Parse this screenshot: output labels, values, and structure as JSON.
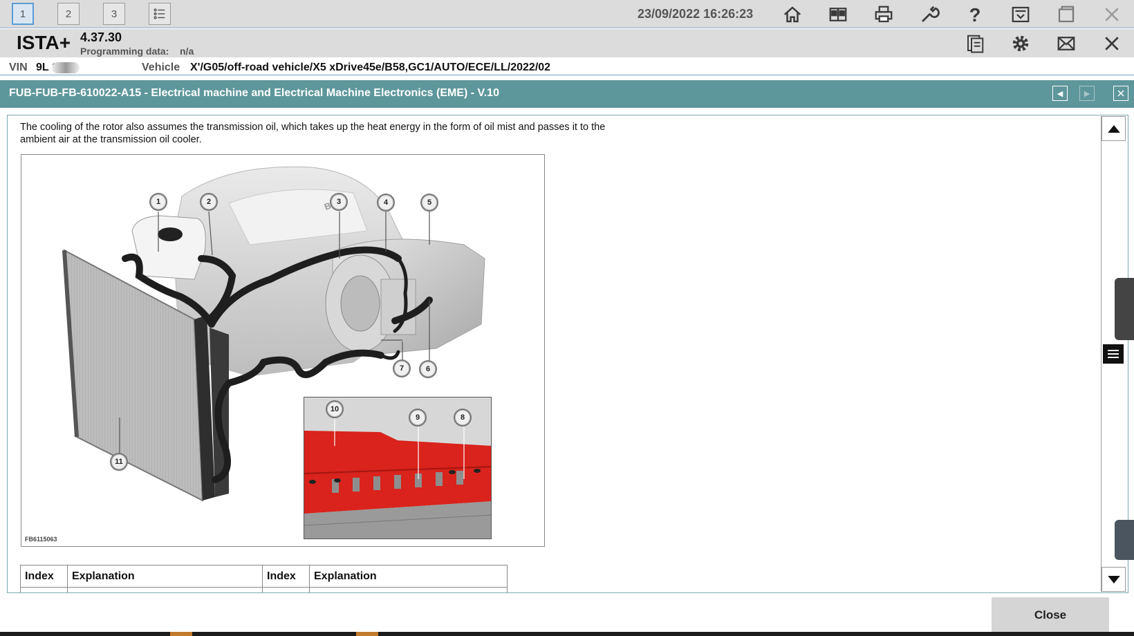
{
  "toolbar": {
    "tabs": [
      {
        "label": "1",
        "active": true
      },
      {
        "label": "2",
        "active": false
      },
      {
        "label": "3",
        "active": false
      }
    ],
    "datetime": "23/09/2022 16:26:23",
    "icons": [
      "list-icon",
      "home-icon",
      "compare-icon",
      "print-icon",
      "wrench-icon",
      "help-icon",
      "download-icon",
      "window-icon",
      "close-icon"
    ]
  },
  "header": {
    "app_name": "ISTA+",
    "version": "4.37.30",
    "programming_label": "Programming data:",
    "programming_value": "n/a",
    "icons": [
      "notes-icon",
      "settings-icon",
      "mail-icon",
      "close-icon"
    ]
  },
  "vehicle": {
    "vin_label": "VIN",
    "vin_value": "9L      1",
    "vehicle_label": "Vehicle",
    "vehicle_value": "X'/G05/off-road vehicle/X5 xDrive45e/B58,GC1/AUTO/ECE/LL/2022/02"
  },
  "document": {
    "title": "FUB-FUB-FB-610022-A15 - Electrical machine and Electrical Machine Electronics (EME) - V.10",
    "paragraph": "The cooling of the rotor also assumes the transmission oil, which takes up the heat energy in the form of oil mist and passes it to the ambient air at the transmission oil cooler.",
    "figure_code": "FB6115063",
    "callouts": [
      "1",
      "2",
      "3",
      "4",
      "5",
      "6",
      "7",
      "8",
      "9",
      "10",
      "11"
    ],
    "table_headers": [
      "Index",
      "Explanation",
      "Index",
      "Explanation"
    ]
  },
  "footer": {
    "close_label": "Close"
  },
  "colors": {
    "title_bar": "#5e979b",
    "toolbar_bg": "#dcdcdc",
    "inset_red": "#d9231c"
  }
}
